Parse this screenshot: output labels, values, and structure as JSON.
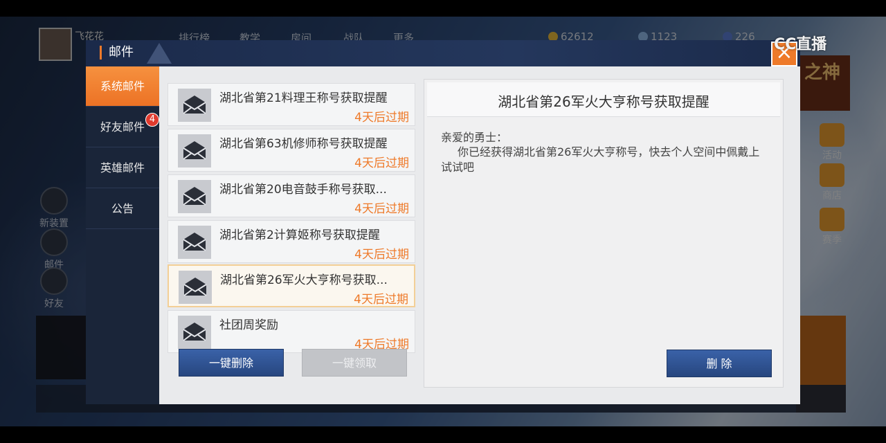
{
  "hud": {
    "player_name": "飞花花",
    "nav_items": [
      "排行榜",
      "教学",
      "房间",
      "战队",
      "更多"
    ],
    "currencies": [
      "62612",
      "1123",
      "226"
    ]
  },
  "watermark": "CC直播",
  "left_sidebar": [
    "新装置",
    "邮件",
    "好友"
  ],
  "right_sidebar": [
    "活动",
    "商店",
    "赛季"
  ],
  "dialog": {
    "title": "邮件",
    "close_label": "×",
    "tabs": [
      {
        "label": "系统邮件",
        "active": true
      },
      {
        "label": "好友邮件",
        "badge": "4"
      },
      {
        "label": "英雄邮件"
      },
      {
        "label": "公告"
      }
    ],
    "mails": [
      {
        "subject": "湖北省第21料理王称号获取提醒",
        "expire": "4天后过期"
      },
      {
        "subject": "湖北省第63机修师称号获取提醒",
        "expire": "4天后过期"
      },
      {
        "subject": "湖北省第20电音鼓手称号获取...",
        "expire": "4天后过期"
      },
      {
        "subject": "湖北省第2计算姬称号获取提醒",
        "expire": "4天后过期"
      },
      {
        "subject": "湖北省第26军火大亨称号获取...",
        "expire": "4天后过期",
        "selected": true
      },
      {
        "subject": "社团周奖励",
        "expire": "4天后过期"
      }
    ],
    "delete_all_label": "一键删除",
    "claim_all_label": "一键领取",
    "detail": {
      "title": "湖北省第26军火大亨称号获取提醒",
      "greeting": "亲爱的勇士：",
      "body": "你已经获得湖北省第26军火大亨称号，快去个人空间中佩戴上试试吧",
      "delete_label": "删 除"
    }
  },
  "colors": {
    "accent": "#ee7a2a",
    "button_blue": "#2f5595",
    "header": "#1b2a4a"
  }
}
